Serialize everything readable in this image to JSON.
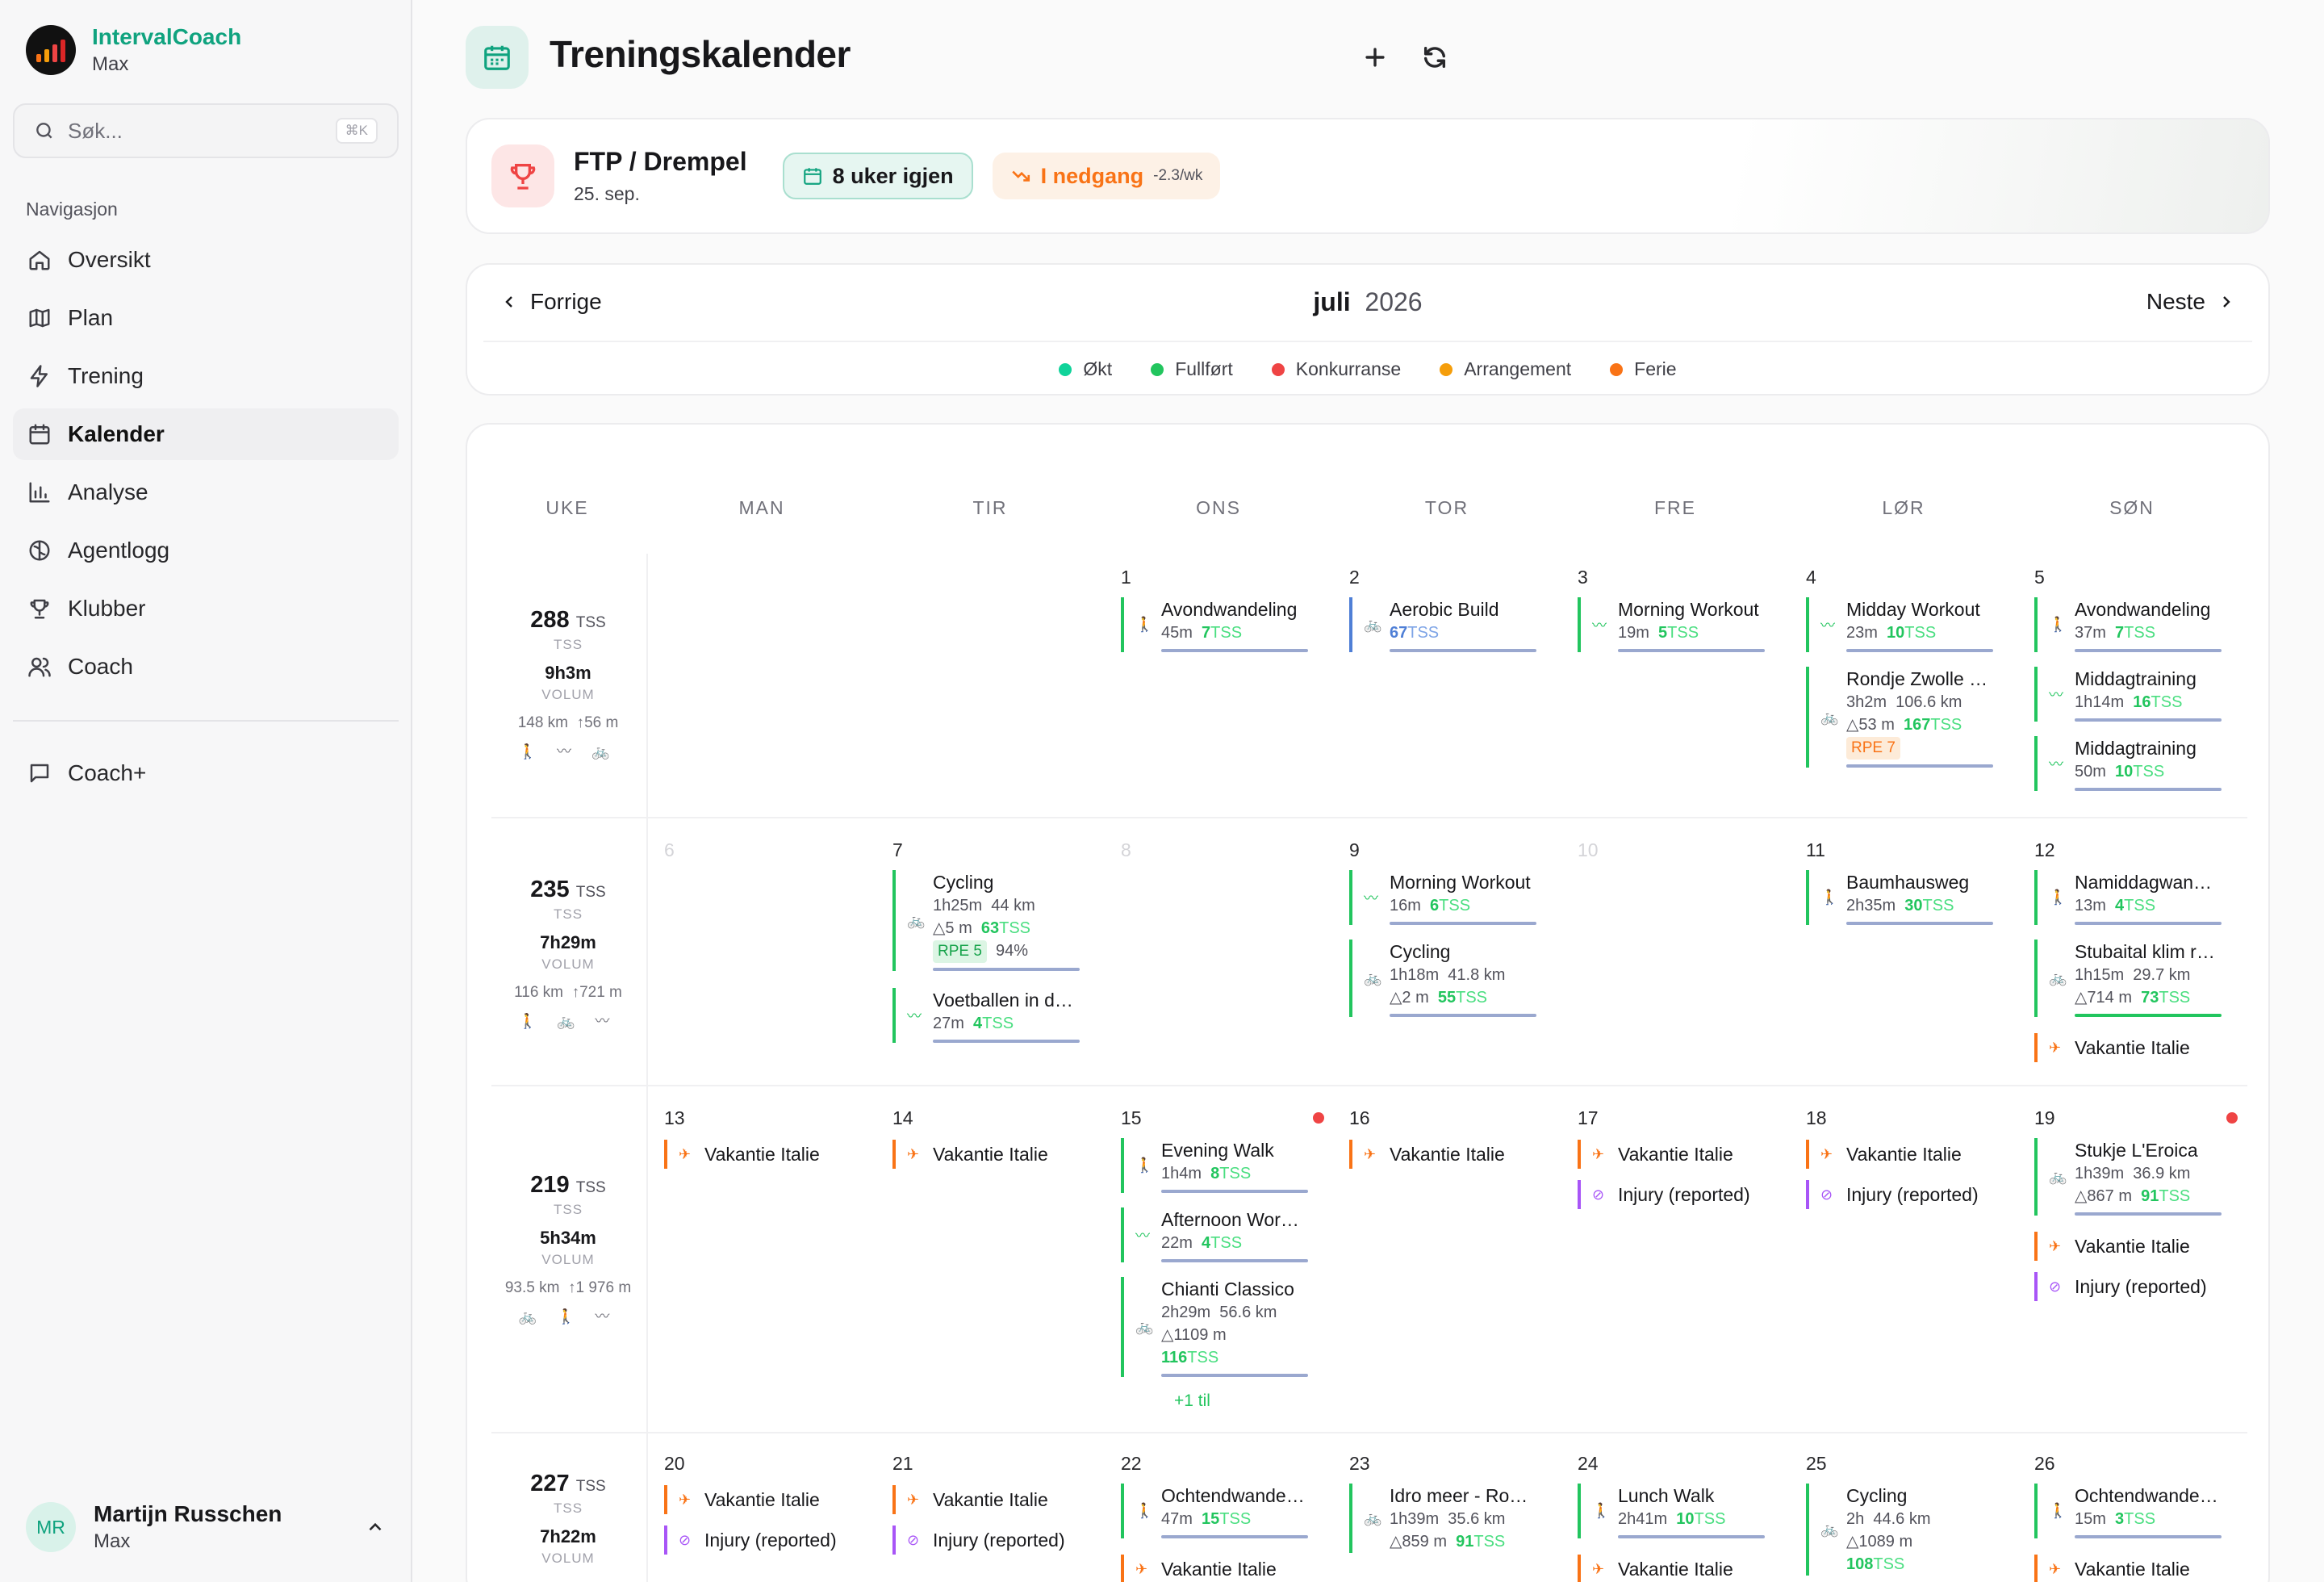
{
  "brand": {
    "name": "IntervalCoach",
    "sub": "Max"
  },
  "search": {
    "placeholder": "Søk...",
    "shortcut": "⌘K"
  },
  "nav": {
    "heading": "Navigasjon",
    "items": [
      "Oversikt",
      "Plan",
      "Trening",
      "Kalender",
      "Analyse",
      "Agentlogg",
      "Klubber",
      "Coach"
    ],
    "extra": "Coach+"
  },
  "user": {
    "initials": "MR",
    "name": "Martijn Russchen",
    "sub": "Max"
  },
  "page": {
    "title": "Treningskalender"
  },
  "goal": {
    "title": "FTP / Drempel",
    "date": "25. sep.",
    "weeks_left": "8 uker igjen",
    "trend": "I nedgang",
    "trend_rate": "-2.3/wk"
  },
  "month": {
    "prev": "Forrige",
    "next": "Neste",
    "name": "juli",
    "year": "2026"
  },
  "legend": [
    {
      "label": "Økt",
      "color": "#10d39a"
    },
    {
      "label": "Fullført",
      "color": "#22c55e"
    },
    {
      "label": "Konkurranse",
      "color": "#ef4444"
    },
    {
      "label": "Arrangement",
      "color": "#f59e0b"
    },
    {
      "label": "Ferie",
      "color": "#f97316"
    }
  ],
  "weekdays": [
    "UKE",
    "MAN",
    "TIR",
    "ONS",
    "TOR",
    "FRE",
    "LØR",
    "SØN"
  ],
  "weeks": [
    {
      "tss": "288",
      "tss_unit": "TSS",
      "tss_label": "TSS",
      "vol": "9h3m",
      "vol_label": "VOLUM",
      "dist": "148 km",
      "elev": "56 m",
      "icons": "🚶 〰 🚲"
    },
    {
      "tss": "235",
      "tss_unit": "TSS",
      "tss_label": "TSS",
      "vol": "7h29m",
      "vol_label": "VOLUM",
      "dist": "116 km",
      "elev": "721 m",
      "icons": "🚶 🚲 〰"
    },
    {
      "tss": "219",
      "tss_unit": "TSS",
      "tss_label": "TSS",
      "vol": "5h34m",
      "vol_label": "VOLUM",
      "dist": "93.5 km",
      "elev": "1 976 m",
      "icons": "🚲 🚶 〰"
    },
    {
      "tss": "227",
      "tss_unit": "TSS",
      "tss_label": "TSS",
      "vol": "7h22m",
      "vol_label": "VOLUM"
    }
  ],
  "days": {
    "w1": [
      "1",
      "2",
      "3",
      "4",
      "5"
    ],
    "w2": [
      "6",
      "7",
      "8",
      "9",
      "10",
      "11",
      "12"
    ],
    "w3": [
      "13",
      "14",
      "15",
      "16",
      "17",
      "18",
      "19"
    ],
    "w4": [
      "20",
      "21",
      "22",
      "23",
      "24",
      "25",
      "26"
    ]
  },
  "acts": {
    "a1": {
      "title": "Avondwandeling",
      "dur": "45m",
      "tss": "7"
    },
    "a2": {
      "title": "Aerobic Build",
      "tss": "67"
    },
    "a3": {
      "title": "Morning Workout",
      "dur": "19m",
      "tss": "5"
    },
    "a4": {
      "title": "Midday Workout",
      "dur": "23m",
      "tss": "10"
    },
    "a5": {
      "title": "Rondje Zwolle e.o.",
      "dur": "3h2m",
      "dist": "106.6 km",
      "elev": "53 m",
      "tss": "167",
      "rpe": "RPE 7"
    },
    "a6": {
      "title": "Avondwandeling",
      "dur": "37m",
      "tss": "7"
    },
    "a7": {
      "title": "Middagtraining",
      "dur": "1h14m",
      "tss": "16"
    },
    "a8": {
      "title": "Middagtraining",
      "dur": "50m",
      "tss": "10"
    },
    "b1": {
      "title": "Cycling",
      "dur": "1h25m",
      "dist": "44 km",
      "elev": "5 m",
      "tss": "63",
      "rpe": "RPE 5",
      "pct": "94%"
    },
    "b2": {
      "title": "Voetballen in de tuin",
      "dur": "27m",
      "tss": "4"
    },
    "b3": {
      "title": "Morning Workout",
      "dur": "16m",
      "tss": "6"
    },
    "b4": {
      "title": "Cycling",
      "dur": "1h18m",
      "dist": "41.8 km",
      "elev": "2 m",
      "tss": "55"
    },
    "b5": {
      "title": "Baumhausweg",
      "dur": "2h35m",
      "tss": "30"
    },
    "b6": {
      "title": "Namiddagwandeling",
      "dur": "13m",
      "tss": "4"
    },
    "b7": {
      "title": "Stubaital klim rondje",
      "dur": "1h15m",
      "dist": "29.7 km",
      "elev": "714 m",
      "tss": "73"
    },
    "c1": {
      "title": "Evening Walk",
      "dur": "1h4m",
      "tss": "8"
    },
    "c2": {
      "title": "Afternoon Workout",
      "dur": "22m",
      "tss": "4"
    },
    "c3": {
      "title": "Chianti Classico",
      "dur": "2h29m",
      "dist": "56.6 km",
      "elev": "1109 m",
      "tss": "116"
    },
    "c4": {
      "title": "Stukje L'Eroica",
      "dur": "1h39m",
      "dist": "36.9 km",
      "elev": "867 m",
      "tss": "91"
    },
    "d1": {
      "title": "Ochtendwandeling",
      "dur": "47m",
      "tss": "15"
    },
    "d2": {
      "title": "Idro meer - Rondje",
      "dur": "1h39m",
      "dist": "35.6 km",
      "elev": "859 m",
      "tss": "91"
    },
    "d3": {
      "title": "Lunch Walk",
      "dur": "2h41m",
      "tss": "10"
    },
    "d4": {
      "title": "Cycling",
      "dur": "2h",
      "dist": "44.6 km",
      "elev": "1089 m",
      "tss": "108"
    },
    "d5": {
      "title": "Ochtendwandeling",
      "dur": "15m",
      "tss": "3"
    }
  },
  "tss_unit": "TSS",
  "vacation": "Vakantie Italie",
  "injury": "Injury (reported)",
  "more": "+1 til"
}
